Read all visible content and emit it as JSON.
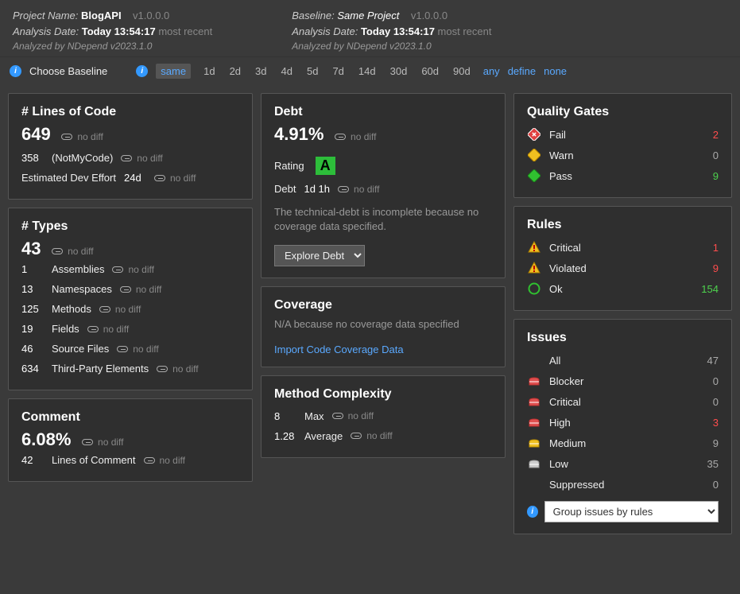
{
  "header": {
    "project": {
      "label": "Project Name:",
      "name": "BlogAPI",
      "version": "v1.0.0.0"
    },
    "analysis": {
      "label": "Analysis Date:",
      "date": "Today 13:54:17",
      "suffix": "most recent"
    },
    "analyzed_by": "Analyzed by NDepend v2023.1.0",
    "baseline": {
      "label": "Baseline:",
      "name": "Same Project",
      "version": "v1.0.0.0"
    },
    "baseline_analysis": {
      "label": "Analysis Date:",
      "date": "Today 13:54:17",
      "suffix": "most recent"
    },
    "baseline_analyzed_by": "Analyzed by NDepend v2023.1.0"
  },
  "baseline_bar": {
    "choose": "Choose Baseline",
    "same": "same",
    "opts": [
      "1d",
      "2d",
      "3d",
      "4d",
      "5d",
      "7d",
      "14d",
      "30d",
      "60d",
      "90d"
    ],
    "any": "any",
    "define": "define",
    "none": "none"
  },
  "nodiff": "no diff",
  "lines": {
    "title": "# Lines of Code",
    "value": "649",
    "notmycode_count": "358",
    "notmycode_label": "(NotMyCode)",
    "effort_label": "Estimated Dev Effort",
    "effort_value": "24d"
  },
  "types": {
    "title": "# Types",
    "value": "43",
    "rows": [
      {
        "n": "1",
        "l": "Assemblies"
      },
      {
        "n": "13",
        "l": "Namespaces"
      },
      {
        "n": "125",
        "l": "Methods"
      },
      {
        "n": "19",
        "l": "Fields"
      },
      {
        "n": "46",
        "l": "Source Files"
      },
      {
        "n": "634",
        "l": "Third-Party Elements"
      }
    ]
  },
  "comment": {
    "title": "Comment",
    "value": "6.08%",
    "row_n": "42",
    "row_l": "Lines of Comment"
  },
  "debt": {
    "title": "Debt",
    "value": "4.91%",
    "rating_label": "Rating",
    "rating_grade": "A",
    "debt_label": "Debt",
    "debt_value": "1d 1h",
    "note": "The technical-debt is incomplete because no coverage data specified.",
    "explore": "Explore Debt"
  },
  "coverage": {
    "title": "Coverage",
    "note": "N/A because no coverage data specified",
    "link": "Import Code Coverage Data"
  },
  "complexity": {
    "title": "Method Complexity",
    "max_n": "8",
    "max_l": "Max",
    "avg_n": "1.28",
    "avg_l": "Average"
  },
  "gates": {
    "title": "Quality Gates",
    "rows": [
      {
        "l": "Fail",
        "v": "2",
        "cls": "red",
        "ic": "fail"
      },
      {
        "l": "Warn",
        "v": "0",
        "cls": "grey",
        "ic": "warn"
      },
      {
        "l": "Pass",
        "v": "9",
        "cls": "green",
        "ic": "pass"
      }
    ]
  },
  "rules": {
    "title": "Rules",
    "rows": [
      {
        "l": "Critical",
        "v": "1",
        "cls": "red",
        "ic": "rcrit"
      },
      {
        "l": "Violated",
        "v": "9",
        "cls": "red",
        "ic": "rwarn"
      },
      {
        "l": "Ok",
        "v": "154",
        "cls": "green",
        "ic": "rok"
      }
    ]
  },
  "issues": {
    "title": "Issues",
    "rows": [
      {
        "l": "All",
        "v": "47",
        "cls": "grey",
        "ic": ""
      },
      {
        "l": "Blocker",
        "v": "0",
        "cls": "grey",
        "ic": "sev-red"
      },
      {
        "l": "Critical",
        "v": "0",
        "cls": "grey",
        "ic": "sev-red"
      },
      {
        "l": "High",
        "v": "3",
        "cls": "red",
        "ic": "sev-red"
      },
      {
        "l": "Medium",
        "v": "9",
        "cls": "grey",
        "ic": "sev-yellow"
      },
      {
        "l": "Low",
        "v": "35",
        "cls": "grey",
        "ic": "sev-grey"
      },
      {
        "l": "Suppressed",
        "v": "0",
        "cls": "grey",
        "ic": ""
      }
    ],
    "group_by": "Group issues by rules"
  }
}
